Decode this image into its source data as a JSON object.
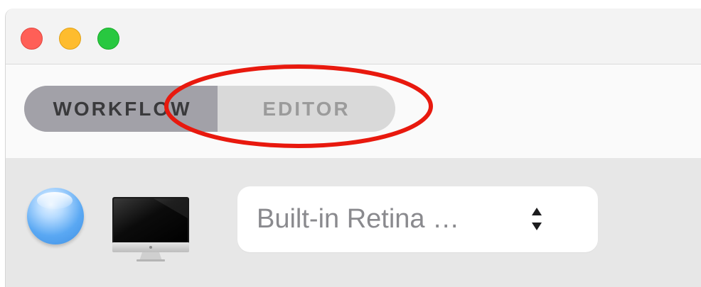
{
  "window": {
    "controls": [
      "close",
      "minimize",
      "zoom"
    ]
  },
  "toolbar": {
    "segments": [
      {
        "label": "WORKFLOW",
        "selected": true
      },
      {
        "label": "EDITOR",
        "selected": false
      }
    ],
    "annotation": {
      "shape": "ellipse",
      "color": "#e8190e"
    }
  },
  "display_panel": {
    "orb_icon": "blue-sphere-icon",
    "device_icon": "imac-icon",
    "display_select": {
      "value": "Built-in Retina …",
      "indicator": "up-down-chevron-icon"
    }
  },
  "colors": {
    "close": "#ff5f57",
    "minimize": "#febc2e",
    "zoom": "#28c840",
    "segment_selected_bg": "#a2a1a8",
    "segment_unselected_bg": "#d9d9d9",
    "annotation": "#e8190e"
  }
}
